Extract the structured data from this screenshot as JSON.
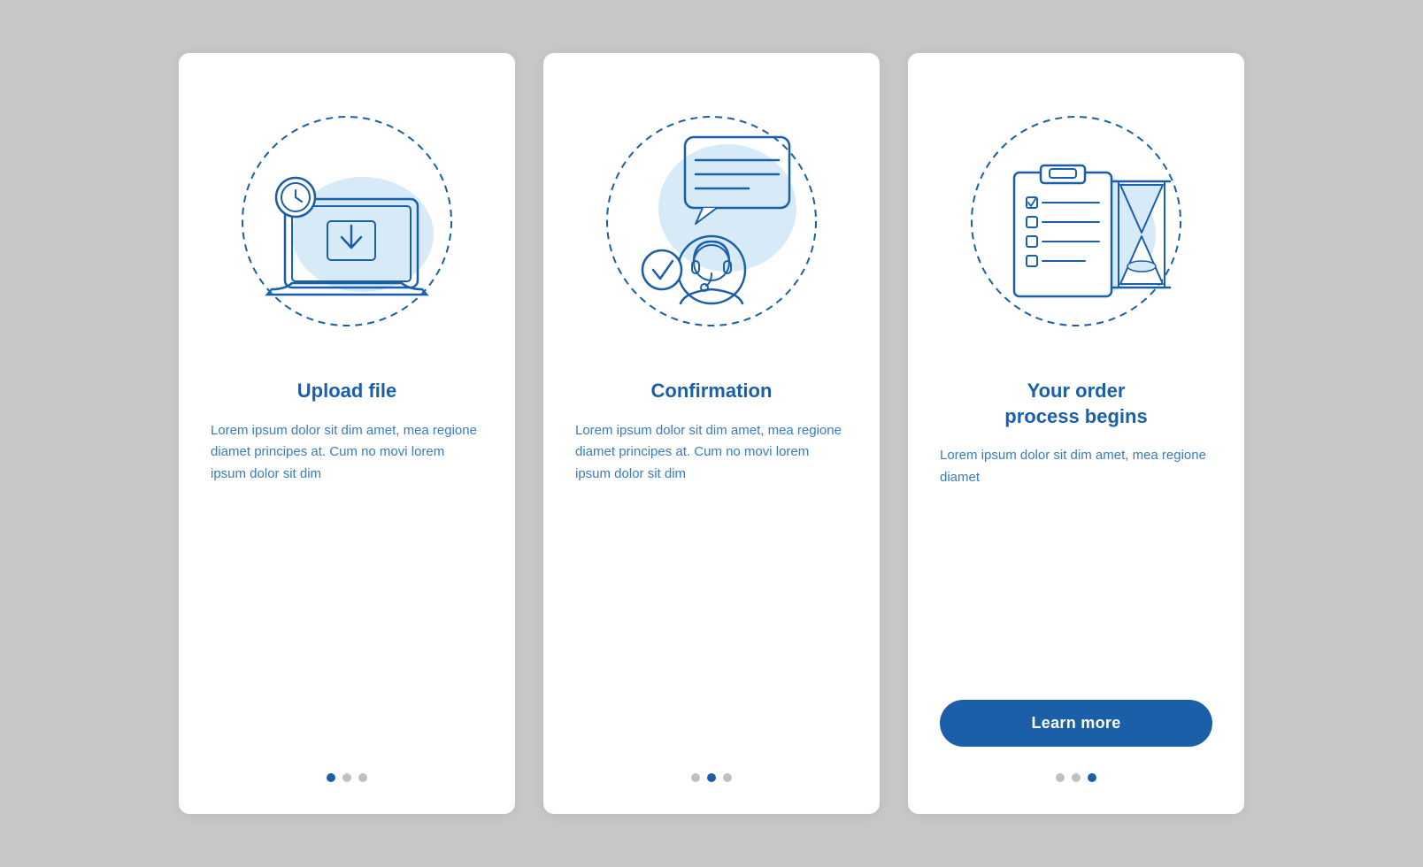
{
  "cards": [
    {
      "id": "upload-file",
      "title": "Upload file",
      "body": "Lorem ipsum dolor sit dim amet, mea regione diamet principes at. Cum no movi lorem ipsum dolor sit dim",
      "dots": [
        "active",
        "inactive",
        "inactive"
      ],
      "show_button": false
    },
    {
      "id": "confirmation",
      "title": "Confirmation",
      "body": "Lorem ipsum dolor sit dim amet, mea regione diamet principes at. Cum no movi lorem ipsum dolor sit dim",
      "dots": [
        "inactive",
        "active",
        "inactive"
      ],
      "show_button": false
    },
    {
      "id": "order-process",
      "title": "Your order\nprocess begins",
      "body": "Lorem ipsum dolor sit dim amet, mea regione diamet",
      "dots": [
        "inactive",
        "inactive",
        "active"
      ],
      "show_button": true,
      "button_label": "Learn more"
    }
  ],
  "accent_color": "#1a5fa8",
  "accent_light": "#b3d4f0",
  "accent_bg": "#d6eaf8"
}
